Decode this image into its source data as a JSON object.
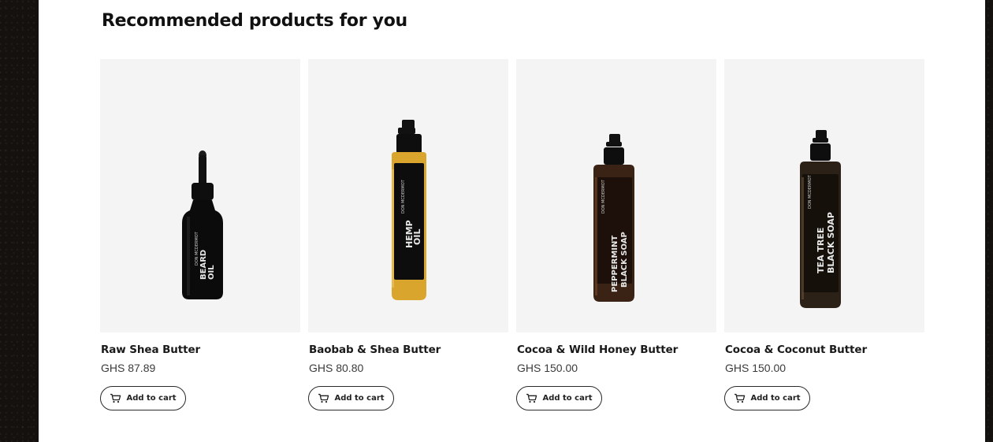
{
  "section": {
    "title": "Recommended products for you"
  },
  "products": [
    {
      "name": "Raw Shea Butter",
      "price": "GHS 87.89",
      "cart_label": "Add to cart",
      "bottle": {
        "brand": "DON\nMCDERMOT",
        "line1": "BEARD",
        "line2": "OIL",
        "liquid": "#0d0d0d"
      }
    },
    {
      "name": "Baobab & Shea Butter",
      "price": "GHS 80.80",
      "cart_label": "Add to cart",
      "bottle": {
        "brand": "DON\nMCDERMOT",
        "line1": "HEMP",
        "line2": "OIL",
        "liquid": "#d9a52c"
      }
    },
    {
      "name": "Cocoa & Wild Honey Butter",
      "price": "GHS 150.00",
      "cart_label": "Add to cart",
      "bottle": {
        "brand": "DON\nMCDERMOT",
        "line1": "PEPPERMINT",
        "line2": "BLACK SOAP",
        "liquid": "#3a2214"
      }
    },
    {
      "name": "Cocoa & Coconut Butter",
      "price": "GHS 150.00",
      "cart_label": "Add to cart",
      "bottle": {
        "brand": "DON\nMCDERMOT",
        "line1": "TEA TREE",
        "line2": "BLACK SOAP",
        "liquid": "#2c2117"
      }
    }
  ]
}
